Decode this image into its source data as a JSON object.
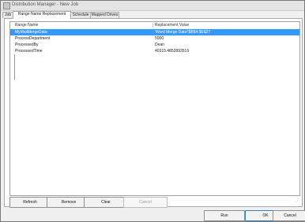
{
  "window": {
    "title": "Distribution Manager - New Job"
  },
  "tabs": [
    {
      "label": "Job"
    },
    {
      "label": "Range Name Replacement"
    },
    {
      "label": "Schedule"
    },
    {
      "label": "Mapped Drives"
    }
  ],
  "grid": {
    "columns": [
      "Range Name",
      "Replacement Value"
    ],
    "rows": [
      {
        "name": "MyMailMergeData",
        "value": "'Word Merge Data'!$B$4:$E$27",
        "selected": true
      },
      {
        "name": "ProcessDepartment",
        "value": "5000",
        "selected": false
      },
      {
        "name": "ProcessedBy",
        "value": "Dean",
        "selected": false
      },
      {
        "name": "ProcessedTime",
        "value": "40315.4852893519",
        "selected": false
      }
    ]
  },
  "grid_buttons": {
    "refresh": "Refresh",
    "remove": "Remove",
    "clear": "Clear",
    "cancel": "Cancel"
  },
  "dialog_buttons": {
    "run": "Run",
    "ok": "OK",
    "cancel": "Cancel"
  },
  "colors": {
    "selection": "#3399ff"
  }
}
